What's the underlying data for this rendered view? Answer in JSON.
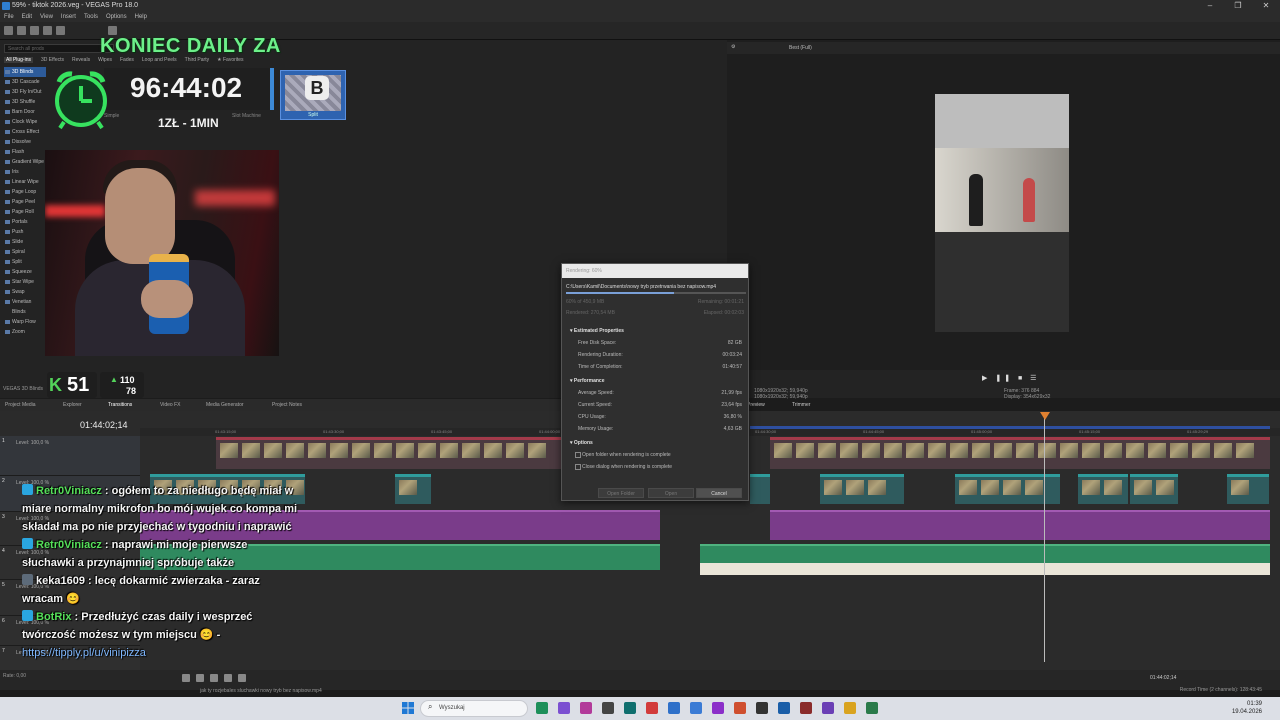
{
  "window": {
    "title": "59% - tiktok 2026.veg - VEGAS Pro 18.0",
    "controls": [
      "–",
      "❐",
      "✕"
    ]
  },
  "menu": [
    "File",
    "Edit",
    "View",
    "Insert",
    "Tools",
    "Options",
    "Help"
  ],
  "transitions": {
    "search_placeholder": "Search all prods",
    "categories": [
      "All Plug-ins",
      "3D Effects",
      "Reveals",
      "Wipes",
      "Fades",
      "Loop and Peels",
      "Third Party",
      "★ Favorites"
    ],
    "items": [
      "3D Blinds",
      "3D Cascade",
      "3D Fly In/Out",
      "3D Shuffle",
      "Barn Door",
      "Clock Wipe",
      "Cross Effect",
      "Dissolve",
      "Flash",
      "Gradient Wipe",
      "Iris",
      "Linear Wipe",
      "Page Loop",
      "Page Peel",
      "Page Roll",
      "Portals",
      "Push",
      "Slide",
      "Spiral",
      "Split",
      "Squeeze",
      "Star Wipe",
      "Swap",
      "Venetian Blinds",
      "Warp Flow",
      "Zoom"
    ],
    "selected_index": 0,
    "thumb_labels": [
      "Simple",
      "Slot Machine",
      "Split"
    ],
    "b_letter": "B",
    "panel_label": "VEGAS 3D Blinds"
  },
  "overlay": {
    "title": "KONIEC DAILY ZA",
    "timer": "96:44:02",
    "rate": "1ZŁ - 1MIN",
    "kick_letter": "K",
    "kick_count": "51",
    "stat_up": "110",
    "stat_down": "78"
  },
  "tabs": [
    "Project Media",
    "Explorer",
    "Transitions",
    "Video FX",
    "Media Generator",
    "Project Notes"
  ],
  "preview": {
    "toolbar": "Best (Full)",
    "tabs": [
      "Preview",
      "Trimmer"
    ],
    "project": "1080x1920x32; 59,940p",
    "preview_res": "1080x1920x32; 59,940p",
    "frame_label": "Frame:",
    "frame": "376 884",
    "display_label": "Display:",
    "display": "354x629x32"
  },
  "timeline": {
    "current_time": "01:44:02;14",
    "level_label": "Level: 100,0 %",
    "ruler_ticks": [
      "01:43:15;00",
      "01:43:30;00",
      "01:43:45;00",
      "01:44:00;00",
      "01:44:15;00",
      "01:44:30;00",
      "01:44:45;00",
      "01:45:00;00",
      "01:45:15;00",
      "01:45:29;29"
    ],
    "end_time": "01:44:02;14",
    "record_time": "Record Time (2 channels): 128:43:45",
    "rate_label": "Rate: 0,00",
    "status_file": "jak ty rozjebales sluchawki nowy tryb bez napisow.mp4"
  },
  "render": {
    "title": "Rendering: 60%",
    "path": "C:\\Users\\Kamil\\Documents\\nowy tryb przetrwania bez napisow.mp4",
    "progress": 0.6,
    "progress_left": "60% of 450,9 MB",
    "remaining": "Remaining: 00:01:21",
    "rendered": "Rendered: 270,54 MB",
    "elapsed": "Elapsed: 00:02:03",
    "sections": {
      "estimated": "Estimated Properties",
      "performance": "Performance",
      "options": "Options"
    },
    "estimated": [
      {
        "label": "Free Disk Space:",
        "value": "82 GB"
      },
      {
        "label": "Rendering Duration:",
        "value": "00:03:24"
      },
      {
        "label": "Time of Completion:",
        "value": "01:40:57"
      }
    ],
    "performance": [
      {
        "label": "Average Speed:",
        "value": "21,99 fps"
      },
      {
        "label": "Current Speed:",
        "value": "23,64 fps"
      },
      {
        "label": "CPU Usage:",
        "value": "36,80 %"
      },
      {
        "label": "Memory Usage:",
        "value": "4,63 GB"
      }
    ],
    "options": [
      "Open folder when rendering is complete",
      "Close dialog when rendering is complete"
    ],
    "buttons": [
      "Open Folder",
      "Open",
      "Cancel"
    ]
  },
  "chat": [
    {
      "name": "Retr0Viniacz",
      "color": "green",
      "text": "ogółem to za niedługo będę miał w miare normalny mikrofon bo mój wujek co kompa mi składał ma po nie przyjechać w tygodniu i naprawić"
    },
    {
      "name": "Retr0Viniacz",
      "color": "green",
      "text": "naprawi mi moje pierwsze słuchawki a przynajmniej spróbuje także"
    },
    {
      "name": "keka1609",
      "color": "white",
      "text": "lecę dokarmić zwierzaka - zaraz wracam 😊"
    },
    {
      "name": "BotRix",
      "color": "green",
      "text": "Przedłużyć czas daily i wesprzeć twórczość możesz w tym miejscu 😊 -"
    },
    {
      "name": "",
      "color": "link",
      "text": "https://tipply.pl/u/vinipizza"
    }
  ],
  "taskbar": {
    "search": "Wyszukaj",
    "time": "01:39",
    "date": "19.04.2026"
  },
  "colors": {
    "accent_green": "#6df08a",
    "render_progress": "#7aa0d8",
    "audio_purple": "#7a3c8a",
    "audio_green": "#2f8a5f"
  }
}
